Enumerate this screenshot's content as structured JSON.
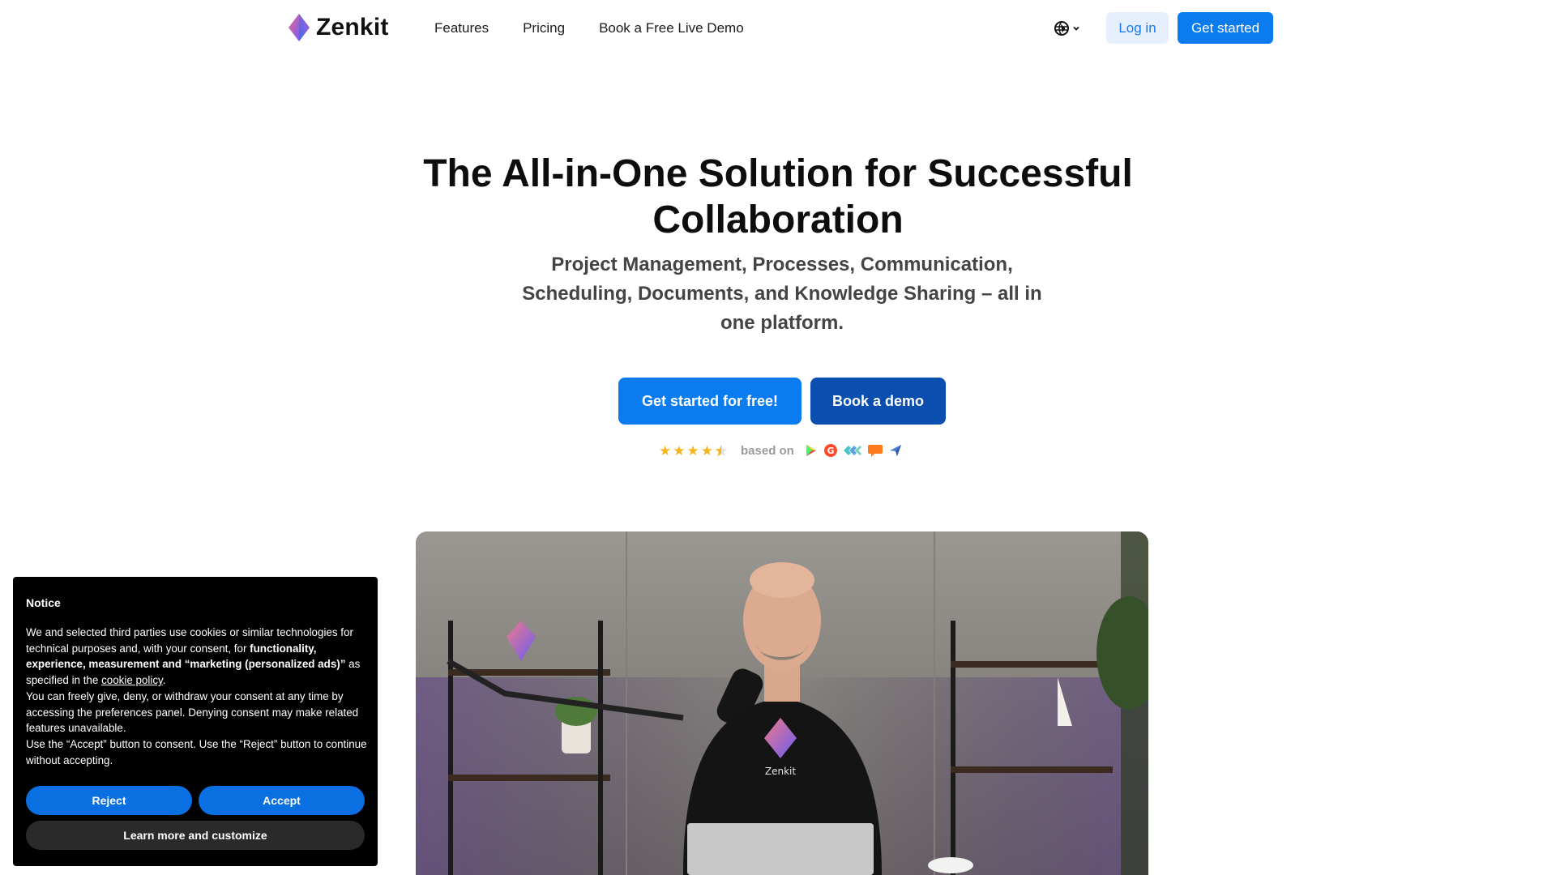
{
  "brand": {
    "name": "Zenkit"
  },
  "nav": {
    "items": [
      {
        "label": "Features"
      },
      {
        "label": "Pricing"
      },
      {
        "label": "Book a Free Live Demo"
      }
    ]
  },
  "header": {
    "language_icon": "globe-icon",
    "login_label": "Log in",
    "get_started_label": "Get started"
  },
  "hero": {
    "title": "The All-in-One Solution for Successful Collaboration",
    "subtitle": "Project Management, Processes, Communication, Scheduling, Documents, and Knowledge Sharing – all in one platform.",
    "cta_primary": "Get started for free!",
    "cta_secondary": "Book a demo",
    "rating": {
      "stars": 4.5,
      "max": 5,
      "based_on_label": "based on",
      "sources": [
        "google-play-icon",
        "g2-icon",
        "capterra-icon",
        "chat-review-icon",
        "paper-plane-icon"
      ]
    }
  },
  "colors": {
    "primary": "#0a7cf0",
    "primary_dark": "#0a4fb0",
    "login_bg": "#e6f0fc",
    "star": "#f6b51c"
  },
  "cookie": {
    "title": "Notice",
    "p1_a": "We and selected third parties use cookies or similar technologies for technical purposes and, with your consent, for ",
    "p1_bold": "functionality, experience, measurement and “marketing (personalized ads)”",
    "p1_b": " as specified in the ",
    "p1_link": "cookie policy",
    "p1_end": ".",
    "p2": "You can freely give, deny, or withdraw your consent at any time by accessing the preferences panel. Denying consent may make related features unavailable.",
    "p3": "Use the “Accept” button to consent. Use the “Reject” button to continue without accepting.",
    "reject_label": "Reject",
    "accept_label": "Accept",
    "learn_label": "Learn more and customize"
  }
}
